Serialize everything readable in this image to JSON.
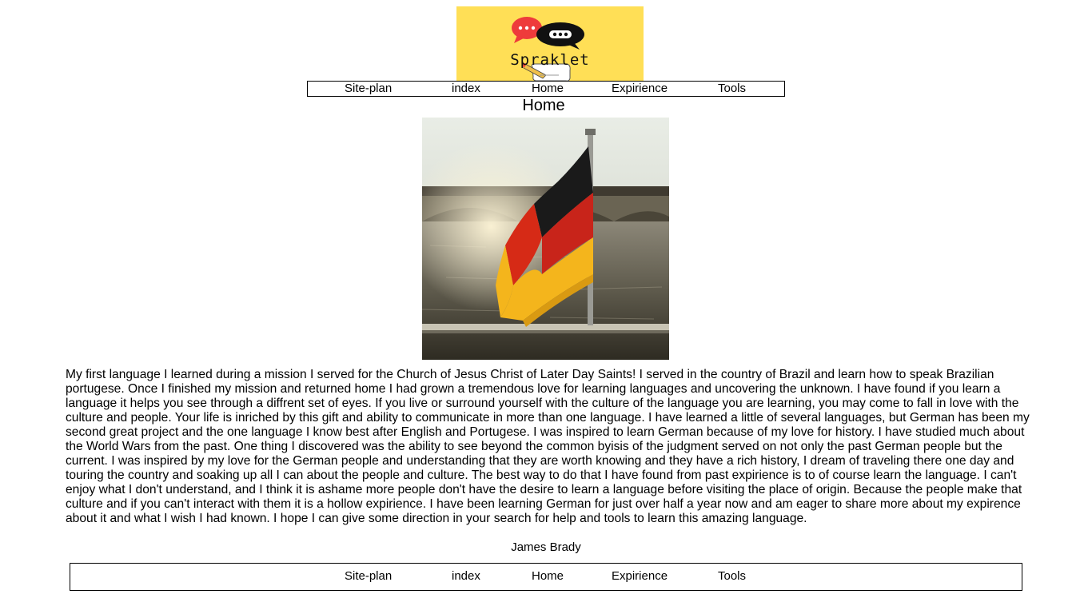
{
  "logo": {
    "wordmark": "Spraklet"
  },
  "nav_top": {
    "items": [
      "Site-plan",
      "index",
      "Home",
      "Expirience",
      "Tools"
    ]
  },
  "page": {
    "title": "Home",
    "body": "My first language I learned during a mission I served for the Church of Jesus Christ of Later Day Saints! I served in the country of Brazil and learn how to speak Brazilian portugese. Once I finished my mission and returned home I had grown a tremendous love for learning languages and uncovering the unknown. I have found if you learn a language it helps you see through a diffrent set of eyes. If you live or surround yourself with the culture of the language you are learning, you may come to fall in love with the culture and people. Your life is inriched by this gift and ability to communicate in more than one language. I have learned a little of several languages, but German has been my second great project and the one language I know best after English and Portugese. I was inspired to learn German because of my love for history. I have studied much about the World Wars from the past. One thing I discovered was the ability to see beyond the common byisis of the judgment served on not only the past German people but the current. I was inspired by my love for the German people and understanding that they are worth knowing and they have a rich history, I dream of traveling there one day and touring the country and soaking up all I can about the people and culture. The best way to do that I have found from past expirience is to of course learn the language. I can't enjoy what I don't understand, and I think it is ashame more people don't have the desire to learn a language before visiting the place of origin. Because the people make that culture and if you can't interact with them it is a hollow expirience. I have been learning German for just over half a year now and am eager to share more about my expirence about it and what I wish I had known. I hope I can give some direction in your search for help and tools to learn this amazing language.",
    "author": "James Brady"
  },
  "nav_bottom": {
    "items": [
      "Site-plan",
      "index",
      "Home",
      "Expirience",
      "Tools"
    ]
  },
  "colors": {
    "logo_background": "#ffdf56",
    "bubble_red": "#ee3b3b",
    "bubble_black": "#111111",
    "flag_black": "#1a1a1a",
    "flag_red": "#d62a16",
    "flag_gold": "#f4b51c"
  },
  "icons": [
    "chat-bubble-red-icon",
    "chat-bubble-black-icon",
    "pencil-scroll-icon"
  ]
}
